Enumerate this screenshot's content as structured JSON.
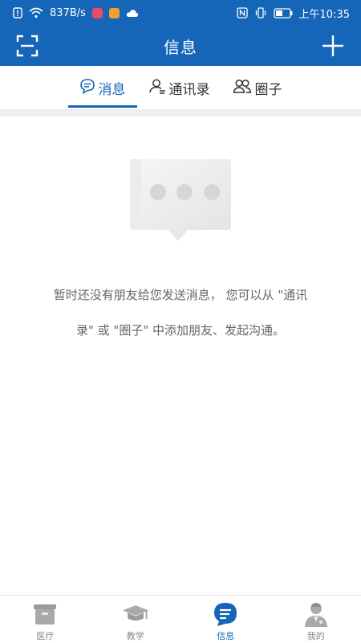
{
  "status_bar": {
    "network_speed": "837B/s",
    "time": "上午10:35",
    "icons": [
      "alert-icon",
      "wifi-icon",
      "app-badge-icon",
      "app-badge-icon",
      "cloud-icon",
      "nfc-icon",
      "vibrate-icon",
      "battery-icon"
    ]
  },
  "app_bar": {
    "title": "信息",
    "left_icon": "scan-icon",
    "right_icon": "plus-icon"
  },
  "tabs": [
    {
      "label": "消息",
      "icon": "chat-bubble-icon",
      "active": true
    },
    {
      "label": "通讯录",
      "icon": "contact-icon",
      "active": false
    },
    {
      "label": "圈子",
      "icon": "group-icon",
      "active": false
    }
  ],
  "empty_state": {
    "line1": "暂时还没有朋友给您发送消息， 您可以从 \"通讯",
    "line2": "录\" 或 \"圈子\" 中添加朋友、发起沟通。"
  },
  "bottom_nav": [
    {
      "label": "医疗",
      "icon": "medical-box-icon",
      "active": false
    },
    {
      "label": "教学",
      "icon": "graduation-cap-icon",
      "active": false
    },
    {
      "label": "信息",
      "icon": "message-icon",
      "active": true
    },
    {
      "label": "我的",
      "icon": "doctor-avatar-icon",
      "active": false
    }
  ],
  "colors": {
    "primary": "#1565b8",
    "inactive": "#888888",
    "text": "#333333"
  }
}
